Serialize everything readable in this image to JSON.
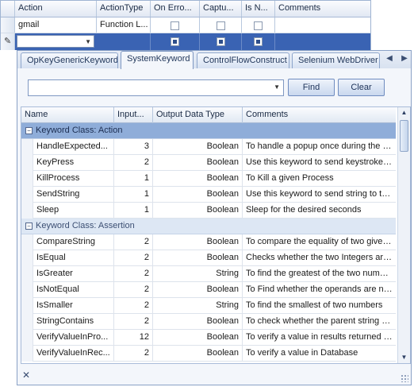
{
  "top_grid": {
    "headers": [
      "Action",
      "ActionType",
      "On Erro...",
      "Captu...",
      "Is N...",
      "Comments"
    ],
    "row1": {
      "action": "gmail",
      "action_type": "Function L..."
    },
    "row2": {
      "action": ""
    }
  },
  "tabs": [
    {
      "label": "OpKeyGenericKeyword",
      "active": false
    },
    {
      "label": "SystemKeyword",
      "active": true
    },
    {
      "label": "ControlFlowConstruct",
      "active": false
    },
    {
      "label": "Selenium WebDriver",
      "active": false
    }
  ],
  "search": {
    "value": "",
    "find_label": "Find",
    "clear_label": "Clear"
  },
  "columns": [
    "Name",
    "Input...",
    "Output Data Type",
    "Comments"
  ],
  "groups": [
    {
      "label": "Keyword Class: Action",
      "rows": [
        {
          "name": "HandleExpected...",
          "inputs": "3",
          "output": "Boolean",
          "comment": "To handle a popup once during the execution"
        },
        {
          "name": "KeyPress",
          "inputs": "2",
          "output": "Boolean",
          "comment": "Use this keyword to send keystrokes to the application"
        },
        {
          "name": "KillProcess",
          "inputs": "1",
          "output": "Boolean",
          "comment": "To Kill a given Process"
        },
        {
          "name": "SendString",
          "inputs": "1",
          "output": "Boolean",
          "comment": "Use this keyword to send string to the application"
        },
        {
          "name": "Sleep",
          "inputs": "1",
          "output": "Boolean",
          "comment": "Sleep for the desired seconds"
        }
      ]
    },
    {
      "label": "Keyword Class: Assertion",
      "rows": [
        {
          "name": "CompareString",
          "inputs": "2",
          "output": "Boolean",
          "comment": "To compare the equality of two given strings"
        },
        {
          "name": "IsEqual",
          "inputs": "2",
          "output": "Boolean",
          "comment": "Checks whether the two Integers are equal"
        },
        {
          "name": "IsGreater",
          "inputs": "2",
          "output": "String",
          "comment": "To find the greatest of the two numbers"
        },
        {
          "name": "IsNotEqual",
          "inputs": "2",
          "output": "Boolean",
          "comment": "To Find whether the operands are not equal"
        },
        {
          "name": "IsSmaller",
          "inputs": "2",
          "output": "String",
          "comment": "To find the smallest of two numbers"
        },
        {
          "name": "StringContains",
          "inputs": "2",
          "output": "Boolean",
          "comment": "To check whether the parent string contains the given string"
        },
        {
          "name": "VerifyValueInPro...",
          "inputs": "12",
          "output": "Boolean",
          "comment": "To verify a value in results returned by a procedure"
        },
        {
          "name": "VerifyValueInRec...",
          "inputs": "2",
          "output": "Boolean",
          "comment": "To verify a value in Database"
        }
      ]
    }
  ],
  "footer": {
    "close_glyph": "✕"
  }
}
